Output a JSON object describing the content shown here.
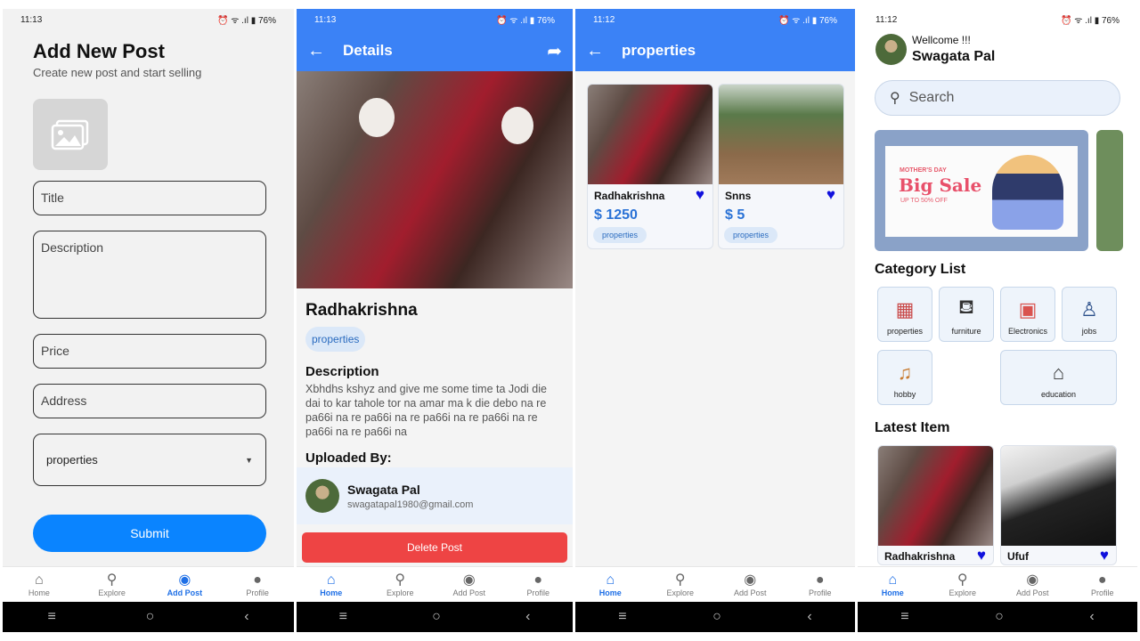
{
  "status_bars": [
    {
      "time": "11:13",
      "right": "⏰ ᯤ .ıl ▮ 76%"
    },
    {
      "time": "11:13",
      "right": "⏰ ᯤ .ıl ▮ 76%"
    },
    {
      "time": "11:12",
      "right": "⏰ ᯤ .ıl ▮ 76%"
    },
    {
      "time": "11:12",
      "right": "⏰ ᯤ .ıl ▮ 76%"
    }
  ],
  "nav": {
    "home": "Home",
    "explore": "Explore",
    "add_post": "Add Post",
    "profile": "Profile"
  },
  "add_post": {
    "title": "Add New Post",
    "subtitle": "Create new post and start selling",
    "title_placeholder": "Title",
    "description_placeholder": "Description",
    "price_placeholder": "Price",
    "address_placeholder": "Address",
    "category_value": "properties",
    "submit": "Submit"
  },
  "details": {
    "appbar_title": "Details",
    "name": "Radhakrishna",
    "category": "properties",
    "description_heading": "Description",
    "description": "Xbhdhs kshyz and give me some time ta Jodi die dai to kar tahole tor na amar ma k die debo na re pa66i na re pa66i na re pa66i na re pa66i na re pa66i na re pa66i na",
    "uploaded_by_heading": "Uploaded By:",
    "uploader_name": "Swagata Pal",
    "uploader_email": "swagatapal1980@gmail.com",
    "delete": "Delete Post"
  },
  "properties": {
    "appbar_title": "properties",
    "items": [
      {
        "name": "Radhakrishna",
        "price": "$ 1250",
        "category": "properties"
      },
      {
        "name": "Snns",
        "price": "$ 5",
        "category": "properties"
      }
    ]
  },
  "home": {
    "welcome": "Wellcome !!!",
    "user": "Swagata Pal",
    "search_placeholder": "Search",
    "banner": {
      "small": "MOTHER'S DAY",
      "big": "Big Sale",
      "off": "UP TO 50% OFF"
    },
    "category_heading": "Category List",
    "categories": [
      "properties",
      "furniture",
      "Electronics",
      "jobs",
      "hobby",
      "education"
    ],
    "latest_heading": "Latest Item",
    "latest": [
      {
        "name": "Radhakrishna"
      },
      {
        "name": "Ufuf"
      }
    ]
  },
  "colors": {
    "primary": "#3b82f6",
    "submit": "#0a84ff",
    "delete": "#ee4444",
    "heart": "#1111dd"
  }
}
